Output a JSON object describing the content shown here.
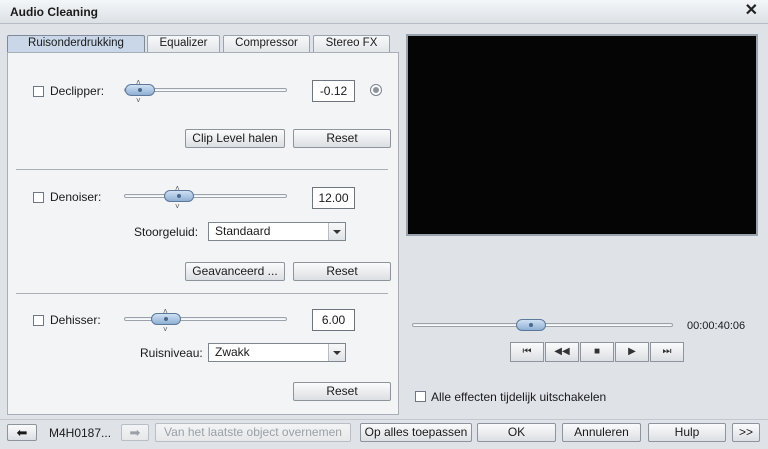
{
  "window": {
    "title": "Audio Cleaning"
  },
  "tabs": [
    {
      "label": "Ruisonderdrukking",
      "active": true
    },
    {
      "label": "Equalizer",
      "active": false
    },
    {
      "label": "Compressor",
      "active": false
    },
    {
      "label": "Stereo FX",
      "active": false
    }
  ],
  "declipper": {
    "label": "Declipper:",
    "checked": false,
    "value": "-0.12",
    "clip_button": "Clip Level halen",
    "reset": "Reset"
  },
  "denoiser": {
    "label": "Denoiser:",
    "checked": false,
    "value": "12.00",
    "noise_label": "Stoorgeluid:",
    "noise_value": "Standaard",
    "advanced_button": "Geavanceerd ...",
    "reset": "Reset"
  },
  "dehisser": {
    "label": "Dehisser:",
    "checked": false,
    "value": "6.00",
    "level_label": "Ruisniveau:",
    "level_value": "Zwakk",
    "reset": "Reset"
  },
  "player": {
    "timecode": "00:00:40:06",
    "disable_effects": "Alle effecten tijdelijk uitschakelen",
    "disable_checked": false
  },
  "footer": {
    "object_name": "M4H0187...",
    "take_over_button": "Van het laatste object overnemen",
    "apply_all_button": "Op alles toepassen",
    "ok_button": "OK",
    "cancel_button": "Annuleren",
    "help_button": "Hulp",
    "more_button": ">>"
  }
}
